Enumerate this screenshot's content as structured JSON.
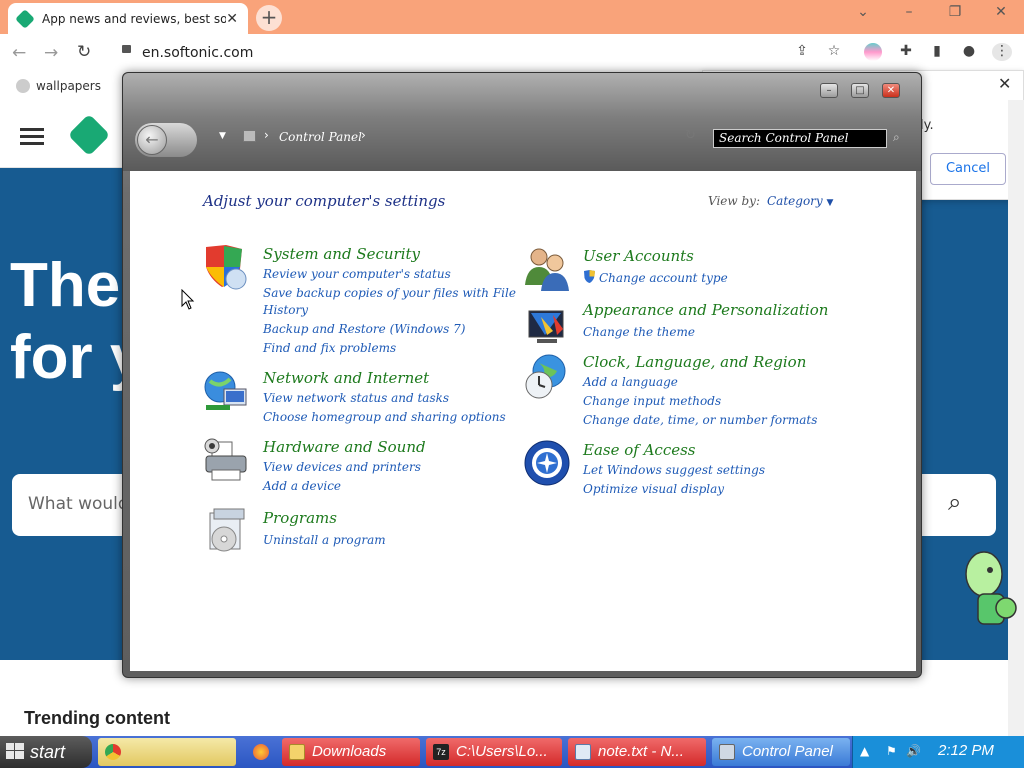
{
  "browser": {
    "tab_title": "App news and reviews, best sof",
    "url": "en.softonic.com",
    "bookmark": "wallpapers"
  },
  "website": {
    "hero_line1": "The",
    "hero_line2": "for y",
    "search_placeholder": "What would",
    "trending": "Trending content",
    "popup_fragment": "ly.",
    "cancel_label": "Cancel"
  },
  "control_panel": {
    "breadcrumb": "Control Panel",
    "search_placeholder": "Search Control Panel",
    "heading": "Adjust your computer's settings",
    "view_by_label": "View by:",
    "view_by_value": "Category",
    "categories": [
      {
        "title": "System and Security",
        "icon": "shield-icon",
        "links": [
          "Review your computer's status",
          "Save backup copies of your files with File",
          "History",
          "Backup and Restore (Windows 7)",
          "Find and fix problems"
        ]
      },
      {
        "title": "Network and Internet",
        "icon": "network-icon",
        "links": [
          "View network status and tasks",
          "Choose homegroup and sharing options"
        ]
      },
      {
        "title": "Hardware and Sound",
        "icon": "printer-icon",
        "links": [
          "View devices and printers",
          "Add a device"
        ]
      },
      {
        "title": "Programs",
        "icon": "programs-icon",
        "links": [
          "Uninstall a program"
        ]
      },
      {
        "title": "User Accounts",
        "icon": "users-icon",
        "links": [
          "Change account type"
        ]
      },
      {
        "title": "Appearance and Personalization",
        "icon": "monitor-icon",
        "links": [
          "Change the theme"
        ]
      },
      {
        "title": "Clock, Language, and Region",
        "icon": "globe-clock-icon",
        "links": [
          "Add a language",
          "Change input methods",
          "Change date, time, or number formats"
        ]
      },
      {
        "title": "Ease of Access",
        "icon": "ease-of-access-icon",
        "links": [
          "Let Windows suggest settings",
          "Optimize visual display"
        ]
      }
    ]
  },
  "taskbar": {
    "start": "start",
    "tasks": [
      "",
      "Downloads",
      "C:\\Users\\Lo...",
      "note.txt - N...",
      "Control Panel"
    ],
    "clock": "2:12 PM"
  },
  "colors": {
    "tab_strip": "#f9a37a",
    "hero": "#175b91",
    "category_title": "#1d7a1d",
    "link": "#1e5ab6",
    "taskbar": "#2b56c2"
  }
}
